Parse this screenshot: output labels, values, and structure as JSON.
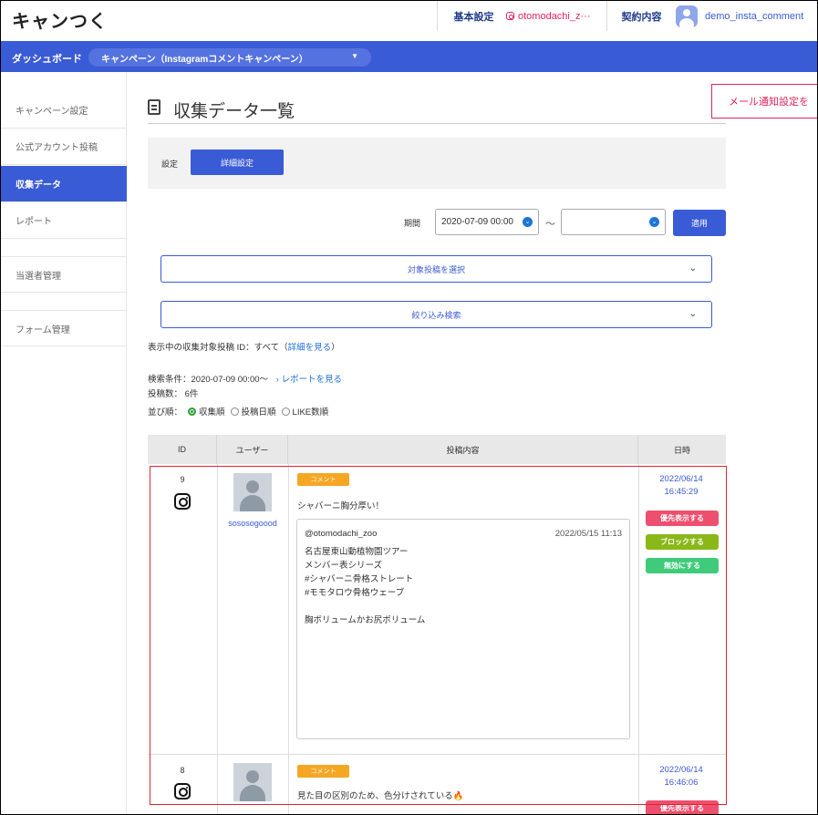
{
  "app": {
    "logo": "キャンつく"
  },
  "topnav": {
    "basic_settings": "基本設定",
    "account": "otomodachi_z···",
    "contract": "契約内容",
    "username": "demo_insta_comment"
  },
  "bluebar": {
    "dashboard": "ダッシュボード",
    "campaign": "キャンペーン（Instagramコメントキャンペーン）",
    "campaign_caret": "▼"
  },
  "sidebar": {
    "items": [
      {
        "label": "キャンペーン設定"
      },
      {
        "label": "公式アカウント投稿"
      },
      {
        "label": "収集データ"
      },
      {
        "label": "レポート"
      },
      {
        "label": "当選者管理"
      },
      {
        "label": "フォーム管理"
      }
    ]
  },
  "page": {
    "title": "収集データ一覧",
    "mail_button": "メール通知設定を",
    "settings_label": "設定",
    "detail_button": "詳細設定",
    "period_label": "期間",
    "date_from": "2020-07-09 00:00",
    "date_to": "",
    "tilde": "〜",
    "apply_button": "適用",
    "select_post": "対象投稿を選択",
    "filter_search": "絞り込み検索",
    "target_prefix": "表示中の収集対象投稿 ID：すべて（",
    "target_link": "詳細を見る",
    "target_suffix": "）",
    "search_condition": "検索条件：2020-07-09 00:00〜",
    "report_link": "› レポートを見る",
    "post_count": "投稿数： 6件",
    "sort_label": "並び順：",
    "sort_options": [
      "収集順",
      "投稿日順",
      "LIKE数順"
    ]
  },
  "table": {
    "headers": [
      "ID",
      "ユーザー",
      "投稿内容",
      "日時"
    ],
    "rows": [
      {
        "id": "9",
        "username": "sososogoood",
        "tag": "コメント",
        "comment": "シャバーニ胸分厚い！",
        "post_account": "@otomodachi_zoo",
        "post_date": "2022/05/15 11:13",
        "post_body": "名古屋東山動植物園ツアー\nメンバー表シリーズ\n#シャバーニ骨格ストレート\n#モモタロウ骨格ウェーブ\n\n胸ボリュームかお尻ボリューム",
        "date": "2022/06/14",
        "time": "16:45:29",
        "actions": {
          "priority": "優先表示する",
          "block": "ブロックする",
          "disable": "無効にする"
        }
      },
      {
        "id": "8",
        "username": "",
        "tag": "コメント",
        "comment": "見た目の区別のため、色分けされている🔥",
        "date": "2022/06/14",
        "time": "16:46:06",
        "actions": {
          "priority": "優先表示する"
        }
      }
    ]
  },
  "colors": {
    "primary": "#3a5bd6",
    "accent_red": "#e0245e",
    "tag_orange": "#f5a623",
    "priority_pink": "#ef4f6e",
    "block_green": "#8ab819",
    "disable_green": "#3fcb7a"
  }
}
